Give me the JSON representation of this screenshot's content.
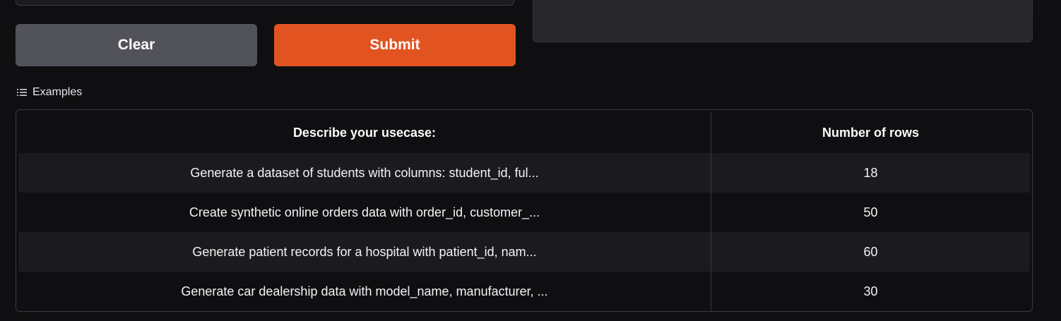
{
  "buttons": {
    "clear_label": "Clear",
    "submit_label": "Submit"
  },
  "colors": {
    "clear_bg": "#52525b",
    "submit_bg": "#e25322",
    "page_bg": "#0f0f11"
  },
  "examples": {
    "label": "Examples",
    "icon": "list-icon",
    "headers": [
      "Describe your usecase:",
      "Number of rows"
    ],
    "rows": [
      [
        "Generate a dataset of students with columns: student_id, ful...",
        "18"
      ],
      [
        "Create synthetic online orders data with order_id, customer_...",
        "50"
      ],
      [
        "Generate patient records for a hospital with patient_id, nam...",
        "60"
      ],
      [
        "Generate car dealership data with model_name, manufacturer, ...",
        "30"
      ]
    ]
  }
}
